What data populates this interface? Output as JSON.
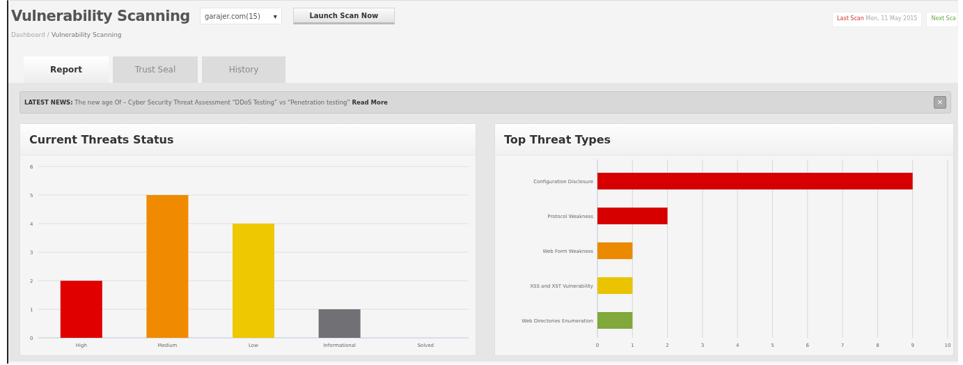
{
  "page": {
    "title": "Vulnerability Scanning",
    "domain_select": {
      "value": "garajer.com(15)",
      "caret": "▾"
    },
    "launch_button": "Launch Scan Now",
    "breadcrumb": [
      "Dashboard",
      "Vulnerability Scanning"
    ],
    "breadcrumb_separator": "/",
    "last_scan": {
      "label": "Last Scan",
      "value": "Mon, 11 May 2015"
    },
    "next_scan": {
      "label": "Next Sca"
    }
  },
  "tabs": [
    {
      "label": "Report",
      "selected": true
    },
    {
      "label": "Trust Seal",
      "selected": false
    },
    {
      "label": "History",
      "selected": false
    }
  ],
  "news": {
    "label": "LATEST NEWS:",
    "text": "The new age Of – Cyber Security Threat Assessment “DDoS Testing” vs “Penetration testing”",
    "link": "Read More",
    "close": "×"
  },
  "threat_status": {
    "title": "Current Threats Status",
    "chart_data": {
      "type": "bar",
      "orientation": "vertical",
      "categories": [
        "High",
        "Medium",
        "Low",
        "Informational",
        "Solved"
      ],
      "colors": [
        "#e00000",
        "#f08a00",
        "#eec800",
        "#707075",
        "#9a9a9a"
      ],
      "series": [
        {
          "values": [
            2,
            5,
            4,
            1,
            0
          ]
        }
      ],
      "grid": true,
      "ylim": [
        0,
        6
      ],
      "yticks": [
        0,
        1,
        2,
        3,
        4,
        5,
        6
      ]
    }
  },
  "threat_types": {
    "title": "Top Threat Types",
    "chart_data": {
      "type": "bar",
      "orientation": "horizontal",
      "categories": [
        "Configuration Disclosure",
        "Protocol Weakness",
        "Web Form Weakness",
        "XSS and XST Vulnerability",
        "Web Directories Enumeration"
      ],
      "colors": [
        "#d60000",
        "#d60000",
        "#eb8a00",
        "#eac400",
        "#80a83a"
      ],
      "series": [
        {
          "values": [
            9,
            2,
            1,
            1,
            1
          ]
        }
      ],
      "grid": true,
      "xlim": [
        0,
        10
      ],
      "xticks": [
        0,
        1,
        2,
        3,
        4,
        5,
        6,
        7,
        8,
        9,
        10
      ]
    }
  }
}
